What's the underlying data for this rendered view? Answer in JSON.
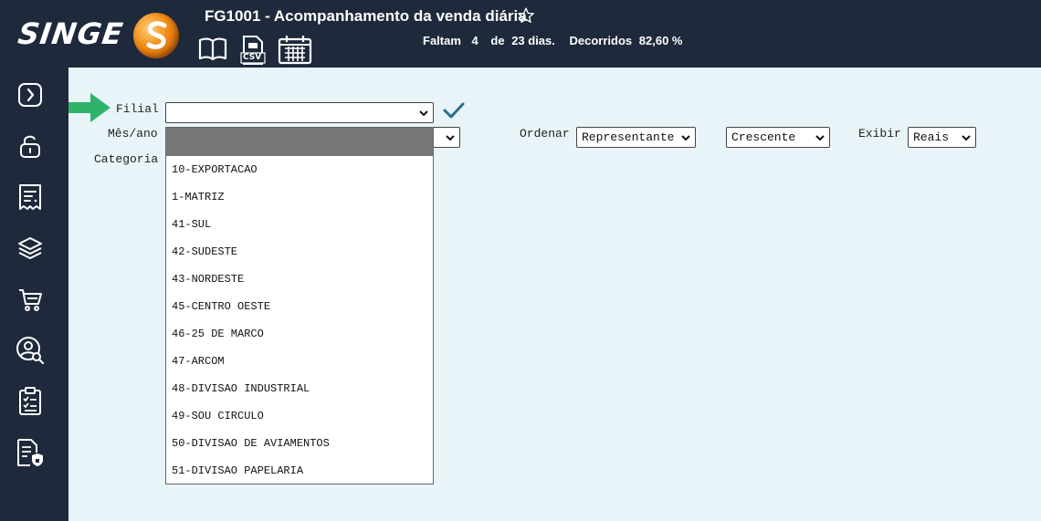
{
  "header": {
    "logo_text": "SINGE",
    "title": "FG1001 - Acompanhamento da venda diária",
    "status": {
      "faltam_label": "Faltam",
      "faltam_value": "4",
      "de_label": "de",
      "days_total": "23 dias.",
      "decorridos_label": "Decorridos",
      "decorridos_value": "82,60 %"
    },
    "csv_label": "CSV"
  },
  "sidebar": {
    "items": [
      {
        "icon": "expand-arrow-icon"
      },
      {
        "icon": "unlock-icon"
      },
      {
        "icon": "receipt-icon"
      },
      {
        "icon": "layers-icon"
      },
      {
        "icon": "cart-icon"
      },
      {
        "icon": "user-search-icon"
      },
      {
        "icon": "clipboard-list-icon"
      },
      {
        "icon": "secure-document-icon"
      }
    ]
  },
  "form": {
    "filial_label": "Filial",
    "filial_value": "",
    "mes_ano_label": "Mês/ano",
    "categoria_label": "Categoria",
    "ordenar_label": "Ordenar",
    "ordenar_value": "Representante",
    "ordem_value": "Crescente",
    "exibir_label": "Exibir",
    "exibir_value": "Reais"
  },
  "dropdown": {
    "options": [
      "10-EXPORTACAO",
      "1-MATRIZ",
      "41-SUL",
      "42-SUDESTE",
      "43-NORDESTE",
      "45-CENTRO OESTE",
      "46-25 DE MARCO",
      "47-ARCOM",
      "48-DIVISAO INDUSTRIAL",
      "49-SOU CIRCULO",
      "50-DIVISAO DE AVIAMENTOS",
      "51-DIVISAO PAPELARIA"
    ]
  },
  "colors": {
    "header_bg": "#1e293b",
    "page_bg": "#e8f4f8",
    "confirm_check": "#2a6f86",
    "arrow": "#2fb36a",
    "dropdown_selected": "#777777"
  }
}
